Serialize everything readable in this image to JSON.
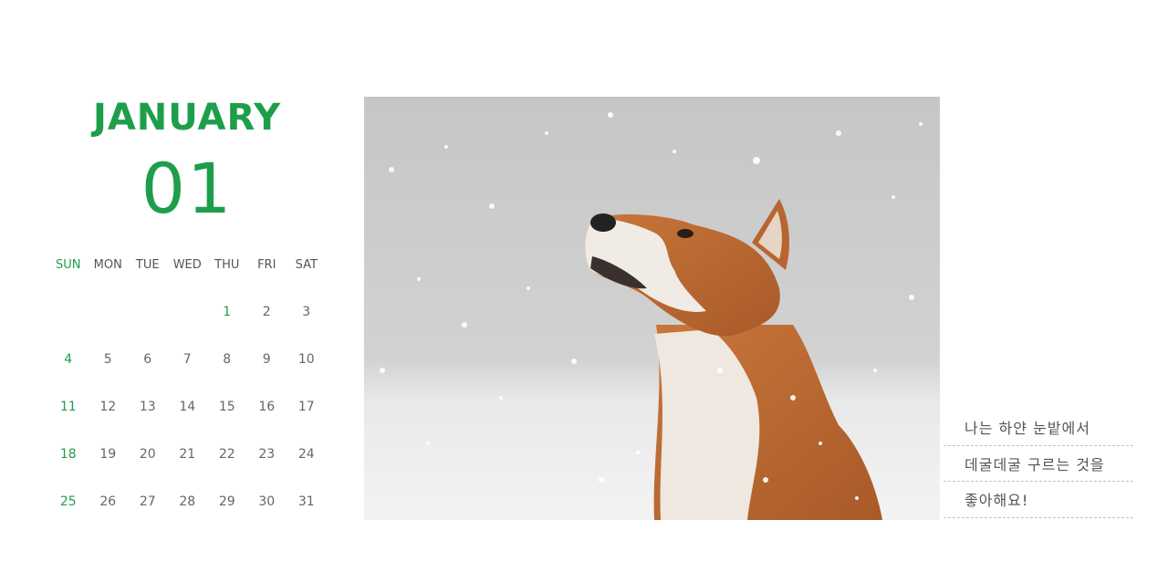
{
  "month_name": "JANUARY",
  "month_number": "01",
  "weekdays": [
    "SUN",
    "MON",
    "TUE",
    "WED",
    "THU",
    "FRI",
    "SAT"
  ],
  "weeks": [
    [
      "",
      "",
      "",
      "",
      "1",
      "2",
      "3"
    ],
    [
      "4",
      "5",
      "6",
      "7",
      "8",
      "9",
      "10"
    ],
    [
      "11",
      "12",
      "13",
      "14",
      "15",
      "16",
      "17"
    ],
    [
      "18",
      "19",
      "20",
      "21",
      "22",
      "23",
      "24"
    ],
    [
      "25",
      "26",
      "27",
      "28",
      "29",
      "30",
      "31"
    ]
  ],
  "photo": {
    "subject": "dog-in-snow"
  },
  "memo_lines": [
    "나는 하얀 눈밭에서",
    "데굴데굴 구르는 것을",
    "좋아해요!"
  ],
  "colors": {
    "accent": "#1e9e4a",
    "text": "#666666"
  }
}
